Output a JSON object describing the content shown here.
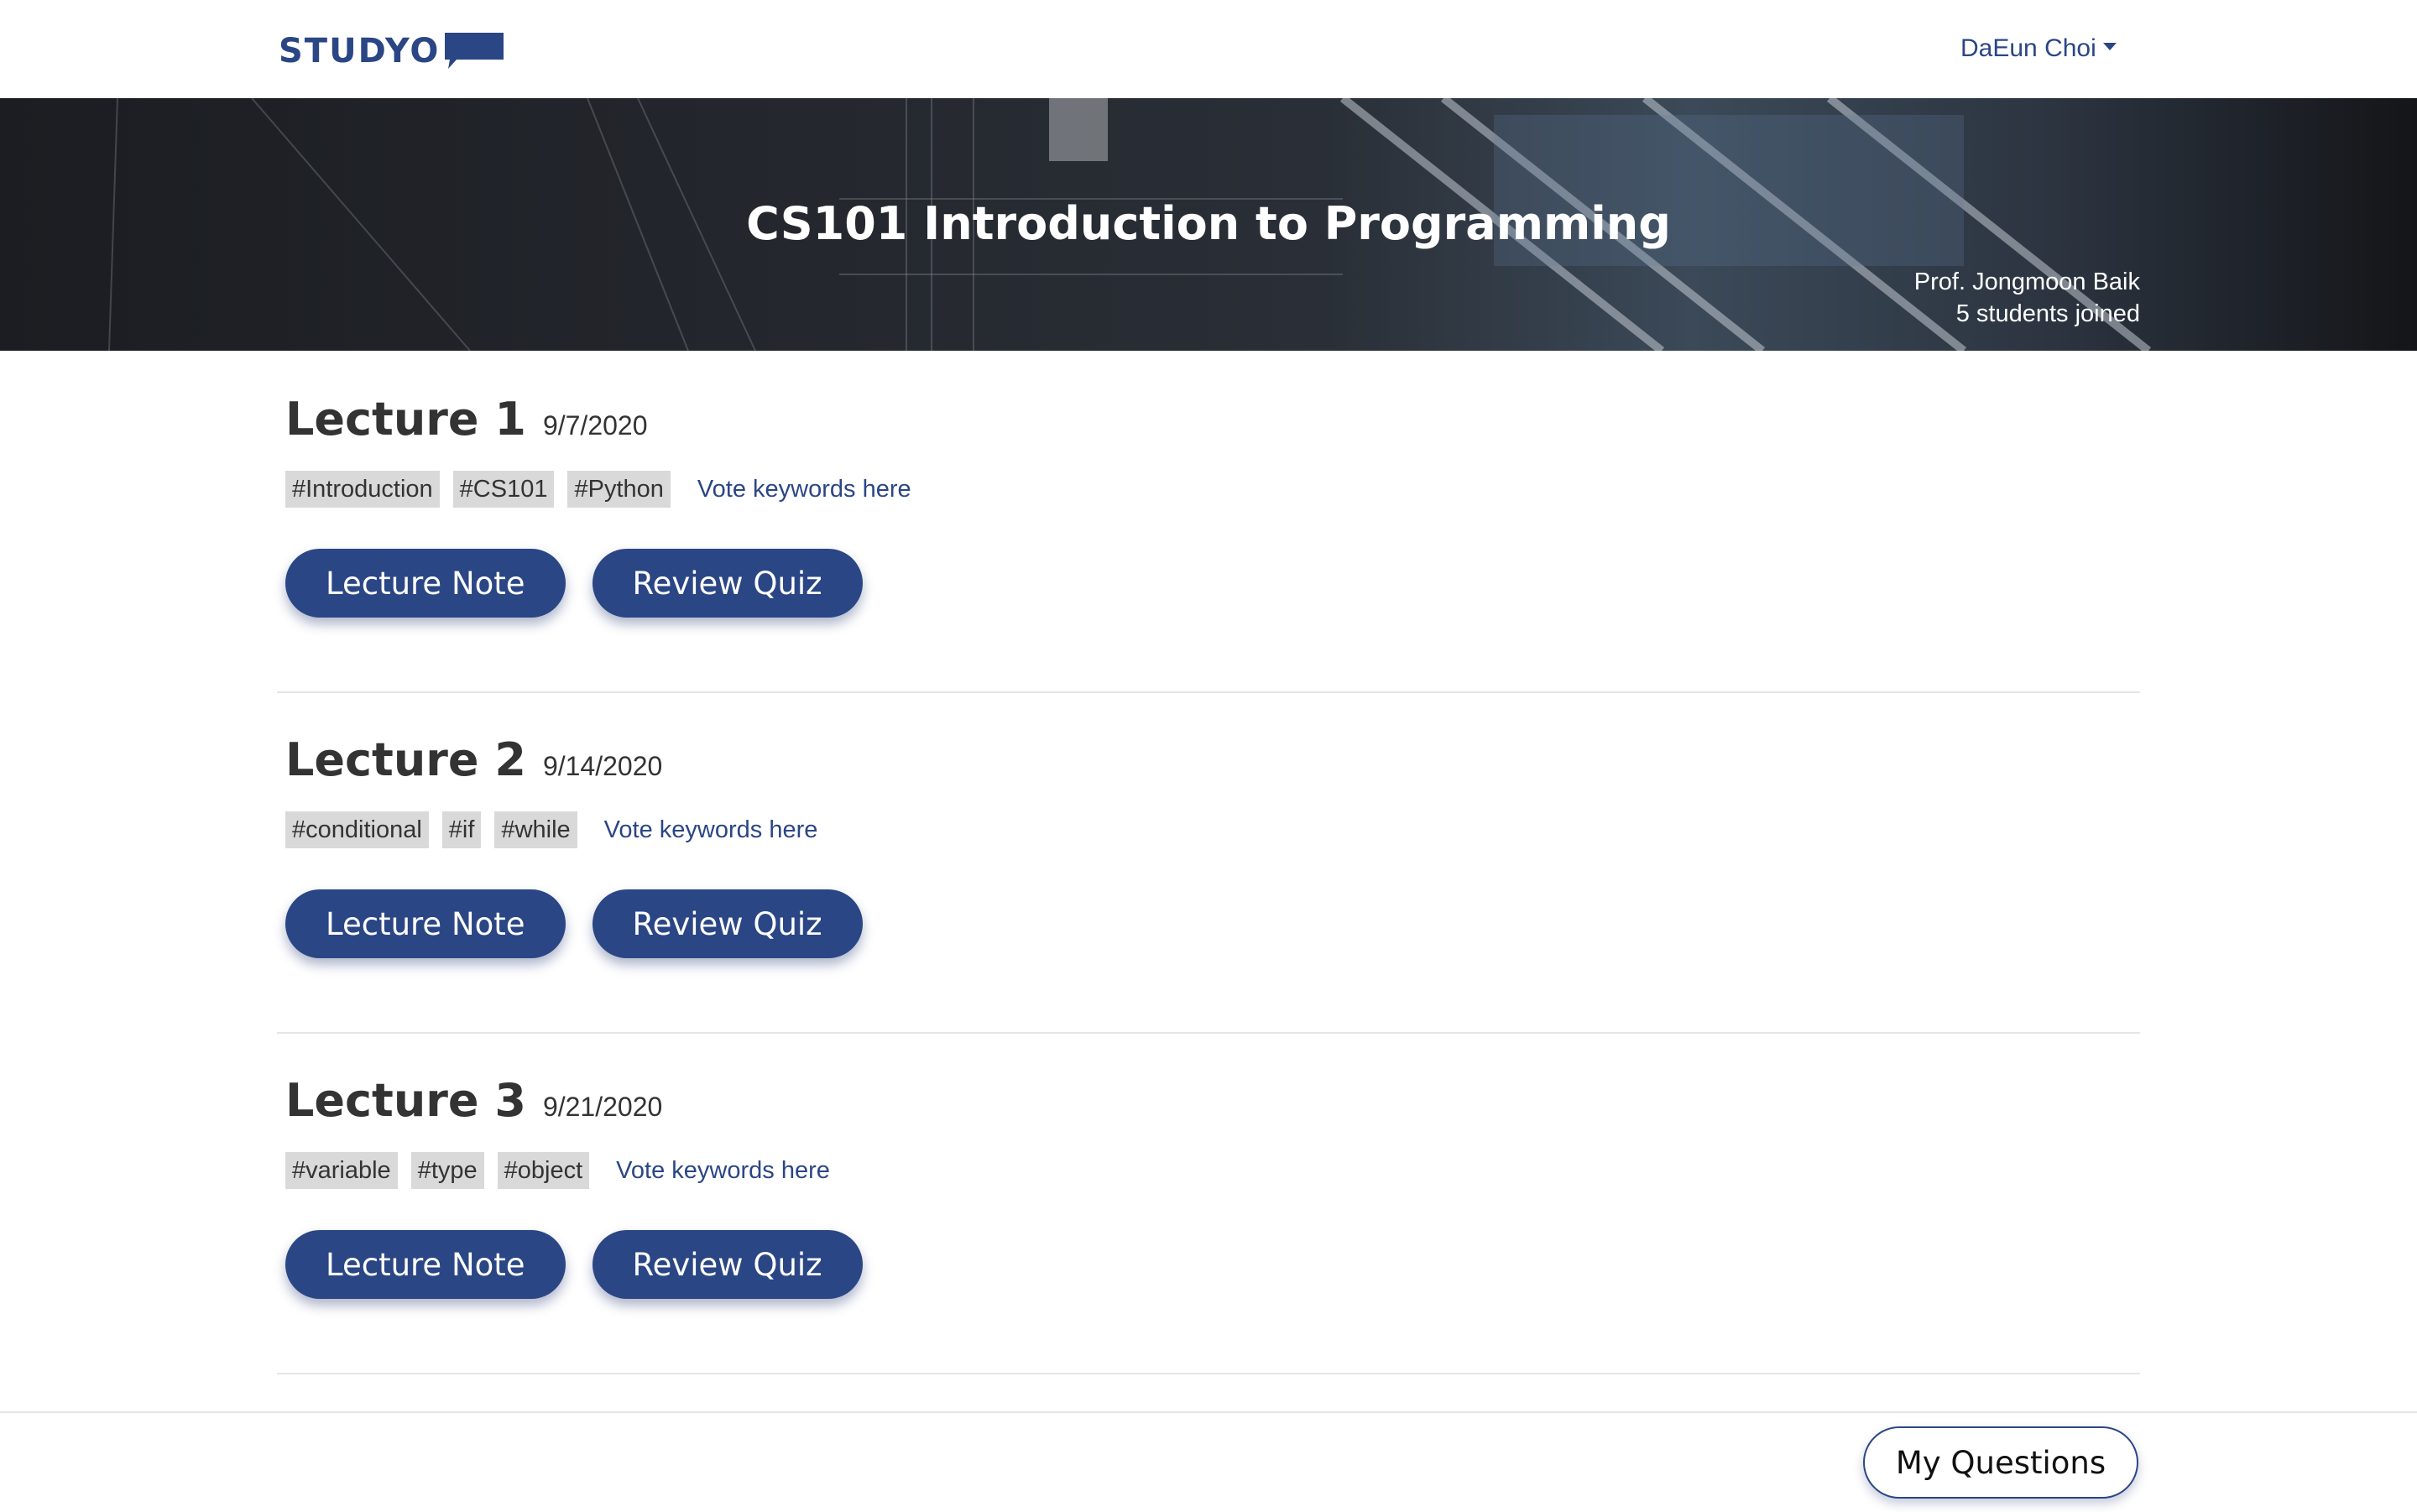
{
  "brand": {
    "name": "STUDYO"
  },
  "user": {
    "name": "DaEun Choi"
  },
  "course": {
    "title": "CS101 Introduction to Programming",
    "professor": "Prof. Jongmoon Baik",
    "students": "5 students joined"
  },
  "lectures": [
    {
      "title": "Lecture 1",
      "date": "9/7/2020",
      "tags": [
        "#Introduction",
        "#CS101",
        "#Python"
      ],
      "vote_label": "Vote keywords here",
      "note_label": "Lecture Note",
      "quiz_label": "Review Quiz"
    },
    {
      "title": "Lecture 2",
      "date": "9/14/2020",
      "tags": [
        "#conditional",
        "#if",
        "#while"
      ],
      "vote_label": "Vote keywords here",
      "note_label": "Lecture Note",
      "quiz_label": "Review Quiz"
    },
    {
      "title": "Lecture 3",
      "date": "9/21/2020",
      "tags": [
        "#variable",
        "#type",
        "#object"
      ],
      "vote_label": "Vote keywords here",
      "note_label": "Lecture Note",
      "quiz_label": "Review Quiz"
    }
  ],
  "footer": {
    "my_questions_label": "My Questions"
  },
  "colors": {
    "brand": "#2b4685",
    "tag_bg": "#d9d9d9",
    "divider": "#e5e5e5"
  },
  "icons": {
    "logo": "speech-bubble-logo-icon",
    "user_menu": "caret-down-icon"
  }
}
